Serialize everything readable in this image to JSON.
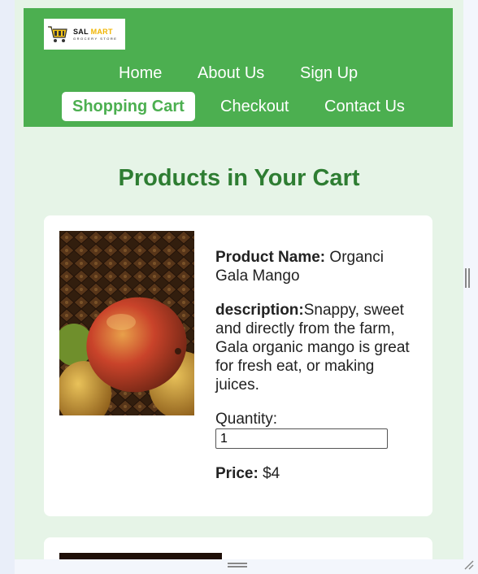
{
  "header": {
    "logo": {
      "brand_a": "SAL",
      "brand_b": "MART",
      "tagline": "GROCERY STORE"
    },
    "nav": [
      {
        "label": "Home",
        "active": false
      },
      {
        "label": "About Us",
        "active": false
      },
      {
        "label": "Sign Up",
        "active": false
      },
      {
        "label": "Shopping Cart",
        "active": true
      },
      {
        "label": "Checkout",
        "active": false
      },
      {
        "label": "Contact Us",
        "active": false
      }
    ]
  },
  "main": {
    "title": "Products in Your Cart",
    "cart_items": [
      {
        "name_label": "Product Name:",
        "name": " Organci Gala Mango",
        "description_label": "description:",
        "description": "Snappy, sweet and directly from the farm, Gala organic mango is great for fresh eat, or making juices.",
        "quantity_label": "Quantity:",
        "quantity": "1",
        "price_label": "Price:",
        "price": " $4"
      }
    ]
  },
  "colors": {
    "header_green": "#4caf50",
    "title_green": "#2e7d32",
    "page_bg": "#e6f4e7"
  }
}
